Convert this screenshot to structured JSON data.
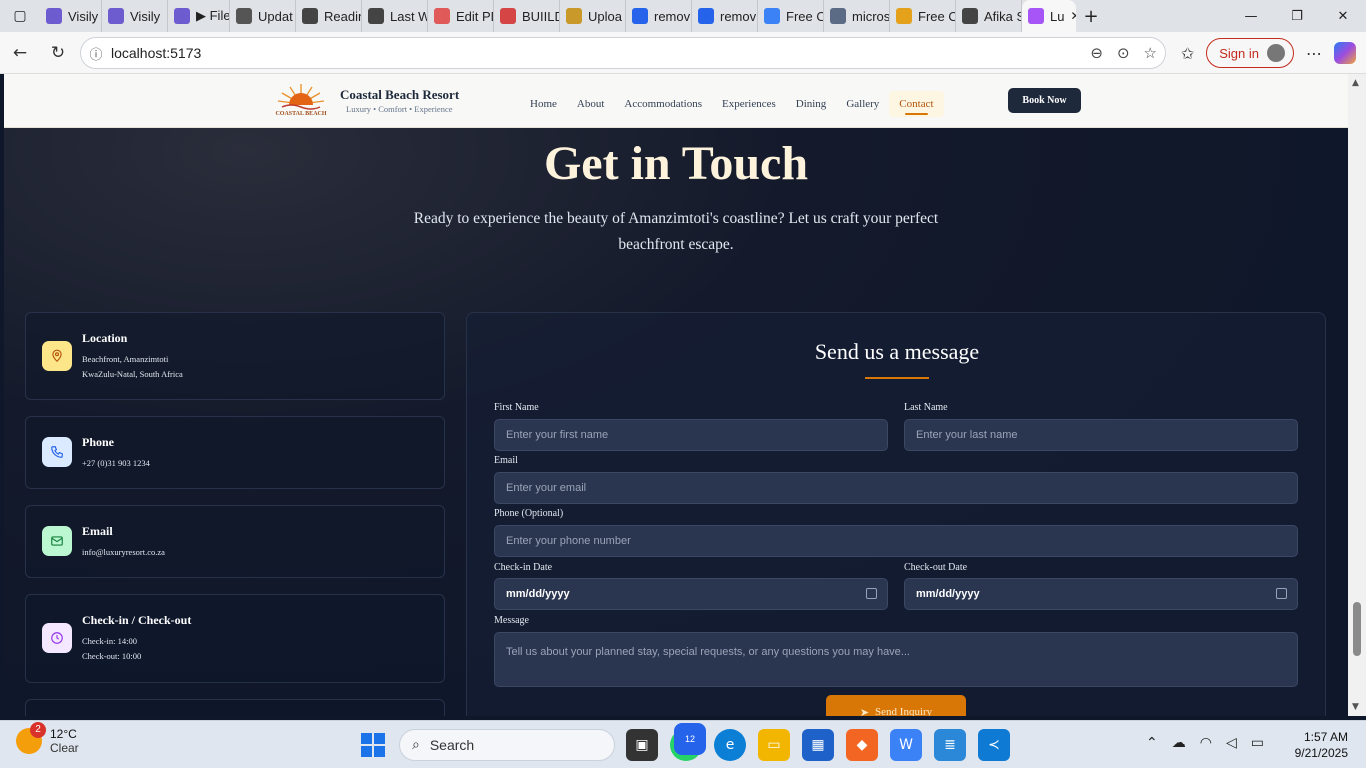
{
  "browser": {
    "tabs": [
      {
        "label": "Visily",
        "color": "#6d5bd0",
        "icon": "visily-icon"
      },
      {
        "label": "Visily",
        "color": "#6d5bd0",
        "icon": "visily-icon"
      },
      {
        "label": "▶ File",
        "color": "#6d5bd0",
        "icon": "visily-icon"
      },
      {
        "label": "Updat",
        "color": "#555555",
        "icon": "openai-icon"
      },
      {
        "label": "Readin",
        "color": "#444444",
        "icon": "readin-icon"
      },
      {
        "label": "Last W",
        "color": "#444444",
        "icon": "scribd-icon"
      },
      {
        "label": "Edit PD",
        "color": "#e05a5a",
        "icon": "pdf-heart-icon"
      },
      {
        "label": "BUIILD",
        "color": "#d64545",
        "icon": "pdf-icon"
      },
      {
        "label": "Uploa",
        "color": "#c99a2a",
        "icon": "box-icon"
      },
      {
        "label": "remov",
        "color": "#2563eb",
        "icon": "bing-icon"
      },
      {
        "label": "remov",
        "color": "#2563eb",
        "icon": "bing-icon"
      },
      {
        "label": "Free O",
        "color": "#3b82f6",
        "icon": "pen-icon"
      },
      {
        "label": "micros",
        "color": "#5b6b85",
        "icon": "search-icon"
      },
      {
        "label": "Free O",
        "color": "#e4a11b",
        "icon": "ms-icon"
      },
      {
        "label": "Afika S",
        "color": "#444444",
        "icon": "globe-icon"
      },
      {
        "label": "Lu",
        "color": "#a855f7",
        "icon": "vite-icon"
      }
    ],
    "url": "localhost:5173",
    "signin_label": "Sign in"
  },
  "site": {
    "brand_title": "Coastal Beach Resort",
    "brand_subtitle": "Luxury • Comfort • Experience",
    "logo_text": "COASTAL BEACH",
    "nav": [
      "Home",
      "About",
      "Accommodations",
      "Experiences",
      "Dining",
      "Gallery",
      "Contact"
    ],
    "active_nav": "Contact",
    "book_label": "Book Now"
  },
  "hero": {
    "title": "Get in Touch",
    "text": "Ready to experience the beauty of Amanzimtoti's coastline? Let us craft your perfect beachfront escape."
  },
  "info_cards": [
    {
      "title": "Location",
      "lines": [
        "Beachfront, Amanzimtoti",
        "KwaZulu-Natal, South Africa"
      ],
      "icon": "location-pin-icon",
      "icon_bg": "#fde68a",
      "icon_color": "#b45309"
    },
    {
      "title": "Phone",
      "lines": [
        "+27 (0)31 903 1234"
      ],
      "icon": "phone-icon",
      "icon_bg": "#dbeafe",
      "icon_color": "#2563eb"
    },
    {
      "title": "Email",
      "lines": [
        "info@luxuryresort.co.za"
      ],
      "icon": "mail-icon",
      "icon_bg": "#bbf7d0",
      "icon_color": "#15803d"
    },
    {
      "title": "Check-in / Check-out",
      "lines": [
        "Check-in: 14:00",
        "Check-out: 10:00"
      ],
      "icon": "clock-icon",
      "icon_bg": "#f3e8ff",
      "icon_color": "#9333ea"
    }
  ],
  "form": {
    "title": "Send us a message",
    "first_name": {
      "label": "First Name",
      "placeholder": "Enter your first name"
    },
    "last_name": {
      "label": "Last Name",
      "placeholder": "Enter your last name"
    },
    "email": {
      "label": "Email",
      "placeholder": "Enter your email"
    },
    "phone": {
      "label": "Phone (Optional)",
      "placeholder": "Enter your phone number"
    },
    "check_in": {
      "label": "Check-in Date",
      "value": "mm/dd/yyyy"
    },
    "check_out": {
      "label": "Check-out Date",
      "value": "mm/dd/yyyy"
    },
    "message": {
      "label": "Message",
      "placeholder": "Tell us about your planned stay, special requests, or any questions you may have..."
    },
    "submit_label": "Send Inquiry"
  },
  "taskbar": {
    "weather_temp": "12°C",
    "weather_desc": "Clear",
    "weather_badge": "2",
    "search_label": "Search",
    "whatsapp_badge": "12",
    "time": "1:57 AM",
    "date": "9/21/2025"
  },
  "colors": {
    "accent": "#d97706",
    "page_bg": "#0f172a"
  }
}
